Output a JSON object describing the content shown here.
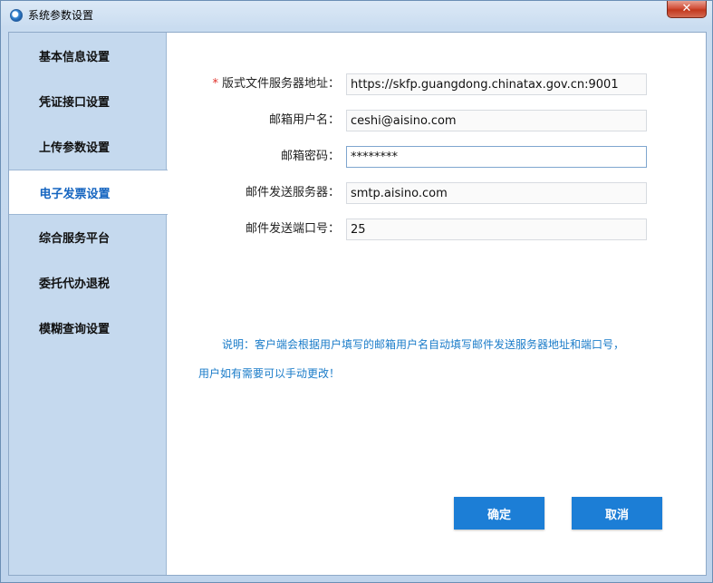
{
  "window": {
    "title": "系统参数设置",
    "close_label": "✕"
  },
  "sidebar": {
    "items": [
      {
        "label": "基本信息设置",
        "active": false
      },
      {
        "label": "凭证接口设置",
        "active": false
      },
      {
        "label": "上传参数设置",
        "active": false
      },
      {
        "label": "电子发票设置",
        "active": true
      },
      {
        "label": "综合服务平台",
        "active": false
      },
      {
        "label": "委托代办退税",
        "active": false
      },
      {
        "label": "模糊查询设置",
        "active": false
      }
    ]
  },
  "form": {
    "required_mark": "*",
    "fields": [
      {
        "label": "版式文件服务器地址：",
        "value": "https://skfp.guangdong.chinatax.gov.cn:9001",
        "required": true
      },
      {
        "label": "邮箱用户名：",
        "value": "ceshi@aisino.com",
        "required": false
      },
      {
        "label": "邮箱密码：",
        "value": "********",
        "required": false,
        "focused": true
      },
      {
        "label": "邮件发送服务器：",
        "value": "smtp.aisino.com",
        "required": false
      },
      {
        "label": "邮件发送端口号：",
        "value": "25",
        "required": false
      }
    ]
  },
  "note": {
    "line1": "说明：客户端会根据用户填写的邮箱用户名自动填写邮件发送服务器地址和端口号，",
    "line2": "用户如有需要可以手动更改！"
  },
  "buttons": {
    "confirm": "确定",
    "cancel": "取消"
  },
  "colors": {
    "accent": "#1c7ed6",
    "active_nav_text": "#1565c0",
    "note_text": "#1b7cc9",
    "required": "#e0302a",
    "sidebar_bg": "#c5d9ee"
  },
  "icons": {
    "title": "app-logo-icon",
    "close": "close-icon"
  }
}
